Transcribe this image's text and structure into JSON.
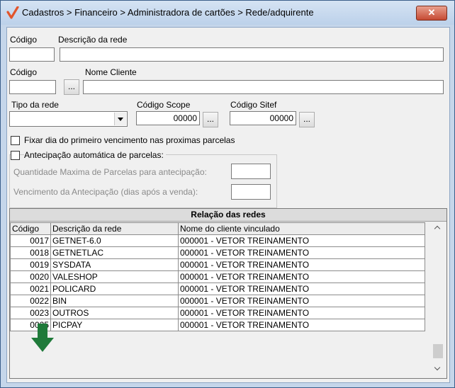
{
  "window": {
    "title": "Cadastros > Financeiro > Administradora de cartões > Rede/adquirente",
    "close_label": "✕"
  },
  "form": {
    "codigo_label": "Código",
    "descricao_label": "Descrição da rede",
    "codigo_value": "",
    "descricao_value": "",
    "cliente_codigo_label": "Código",
    "nome_cliente_label": "Nome Cliente",
    "cliente_codigo_value": "",
    "nome_cliente_value": "",
    "lookup_label": "...",
    "tipo_rede_label": "Tipo da rede",
    "tipo_rede_value": "",
    "scope_label": "Código Scope",
    "scope_value": "00000",
    "sitef_label": "Código Sitef",
    "sitef_value": "00000",
    "fixar_label": "Fixar dia do primeiro vencimento nas proximas parcelas",
    "antecipacao_label": "Antecipação automática de parcelas:",
    "qtd_max_label": "Quantidade Maxima de Parcelas para antecipação:",
    "qtd_max_value": "",
    "venc_label": "Vencimento da Antecipação (dias após a venda):",
    "venc_value": ""
  },
  "grid": {
    "caption": "Relação das redes",
    "columns": [
      "Código",
      "Descrição da rede",
      "Nome do cliente vinculado"
    ],
    "rows": [
      [
        "0017",
        "GETNET-6.0",
        "000001 - VETOR TREINAMENTO"
      ],
      [
        "0018",
        "GETNETLAC",
        "000001 - VETOR TREINAMENTO"
      ],
      [
        "0019",
        "SYSDATA",
        "000001 - VETOR TREINAMENTO"
      ],
      [
        "0020",
        "VALESHOP",
        "000001 - VETOR TREINAMENTO"
      ],
      [
        "0021",
        "POLICARD",
        "000001 - VETOR TREINAMENTO"
      ],
      [
        "0022",
        "BIN",
        "000001 - VETOR TREINAMENTO"
      ],
      [
        "0023",
        "OUTROS",
        "000001 - VETOR TREINAMENTO"
      ],
      [
        "0025",
        "PICPAY",
        "000001 - VETOR TREINAMENTO"
      ]
    ]
  },
  "colors": {
    "accent": "#e2552b",
    "arrow": "#1f7a3a",
    "titlebar": "#c9d9ee"
  },
  "icons": {
    "app": "check-mark-icon",
    "annotation": "down-arrow-icon"
  }
}
